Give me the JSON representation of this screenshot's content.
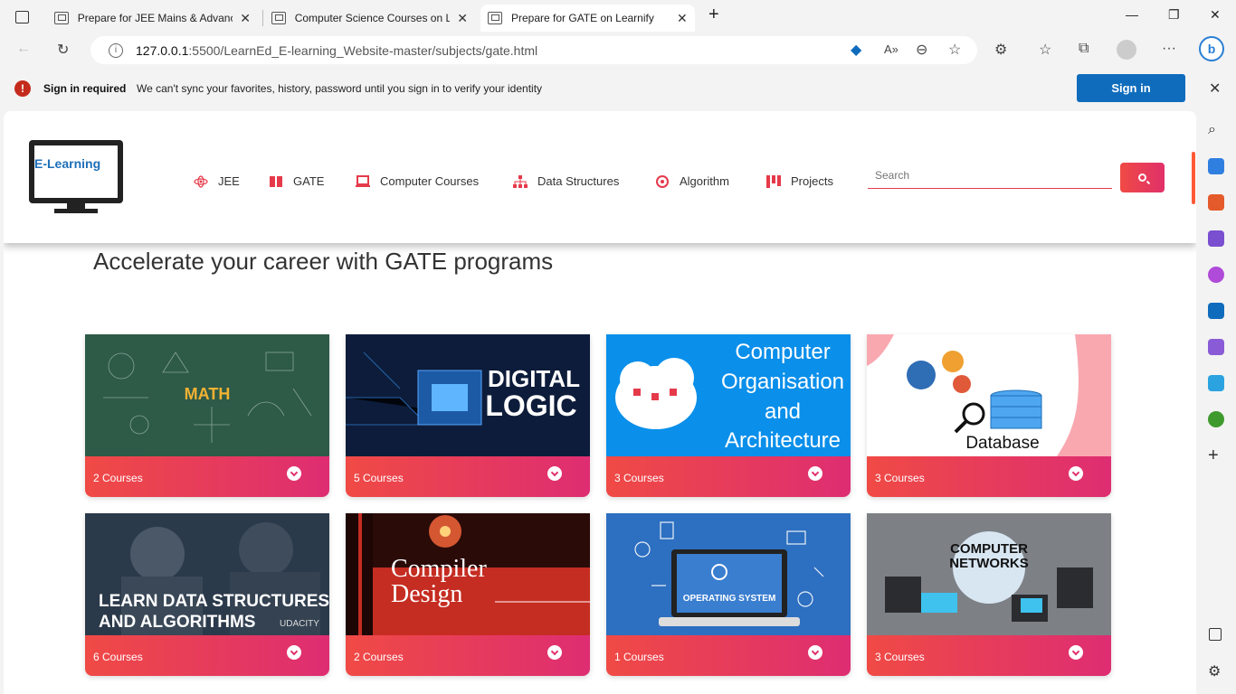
{
  "tabs": [
    {
      "title": "Prepare for JEE Mains & Advance"
    },
    {
      "title": "Computer Science Courses on Le"
    },
    {
      "title": "Prepare for GATE on Learnify"
    }
  ],
  "address": {
    "host": "127.0.0.1",
    "path": ":5500/LearnEd_E-learning_Website-master/subjects/gate.html"
  },
  "sync": {
    "title": "Sign in required",
    "message": "We can't sync your favorites, history, password until you sign in to verify your identity",
    "button": "Sign in"
  },
  "logo": {
    "text": "E-Learning"
  },
  "nav": [
    {
      "label": "JEE",
      "color": "#e53a4a"
    },
    {
      "label": "GATE",
      "color": "#e53a4a"
    },
    {
      "label": "Computer Courses",
      "color": "#e53a4a"
    },
    {
      "label": "Data Structures",
      "color": "#e53a4a"
    },
    {
      "label": "Algorithm",
      "color": "#e53a4a"
    },
    {
      "label": "Projects",
      "color": "#e53a4a"
    }
  ],
  "search": {
    "placeholder": "Search"
  },
  "heading": "Accelerate your career with GATE programs",
  "cards": [
    {
      "art": "MATH",
      "count": "2 Courses"
    },
    {
      "art": "DIGITAL LOGIC",
      "count": "5 Courses"
    },
    {
      "art": "Computer Organisation and Architecture",
      "count": "3 Courses"
    },
    {
      "art": "Database",
      "count": "3 Courses"
    },
    {
      "art": "LEARN DATA STRUCTURES AND ALGORITHMS",
      "count": "6 Courses"
    },
    {
      "art": "Compiler Design",
      "count": "2 Courses"
    },
    {
      "art": "OPERATING SYSTEM",
      "count": "1 Courses"
    },
    {
      "art": "COMPUTER NETWORKS",
      "count": "3 Courses"
    }
  ],
  "colors": {
    "accent": "#e53a4a",
    "signin": "#0f6cbd"
  }
}
